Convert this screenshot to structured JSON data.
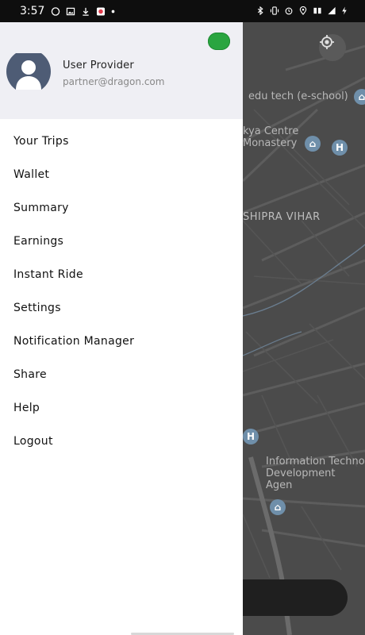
{
  "status_bar": {
    "time": "3:57",
    "left_icons": [
      "whatsapp-icon",
      "gallery-icon",
      "download-icon",
      "app-icon",
      "dot-icon"
    ],
    "right_icons": [
      "bluetooth-icon",
      "vibrate-icon",
      "alarm-icon",
      "location-icon",
      "data-icon",
      "signal-icon",
      "battery-icon"
    ]
  },
  "drawer": {
    "user_name": "User Provider",
    "user_email": "partner@dragon.com",
    "online_color": "#2aa540",
    "menu": [
      {
        "label": "Your Trips"
      },
      {
        "label": "Wallet"
      },
      {
        "label": "Summary"
      },
      {
        "label": "Earnings"
      },
      {
        "label": "Instant Ride"
      },
      {
        "label": "Settings"
      },
      {
        "label": "Notification Manager"
      },
      {
        "label": "Share"
      },
      {
        "label": "Help"
      },
      {
        "label": "Logout"
      }
    ]
  },
  "map": {
    "labels": {
      "school": "edu tech (e-school)",
      "centre_line1": "kya Centre",
      "centre_line2": "Monastery",
      "district": "SHIPRA VIHAR",
      "info_line1": "Information Techno",
      "info_line2": "Development Agen"
    }
  }
}
